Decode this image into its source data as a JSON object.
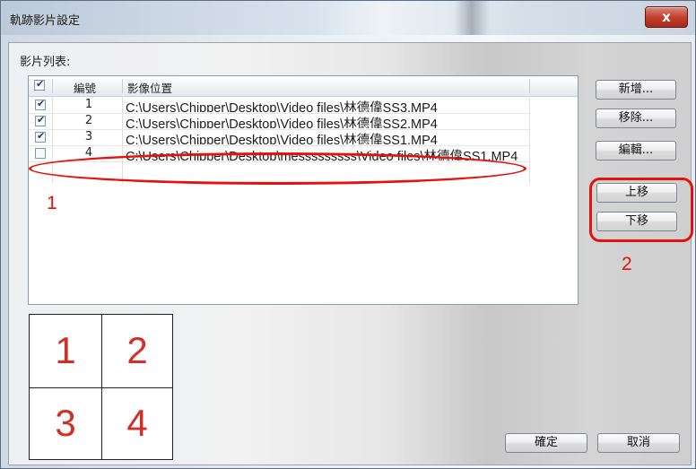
{
  "window": {
    "title": "軌跡影片設定",
    "close_label": "x"
  },
  "list": {
    "label": "影片列表:",
    "headers": {
      "number": "編號",
      "location": "影像位置"
    },
    "rows": [
      {
        "checked": true,
        "number": "1",
        "path": "C:\\Users\\Chipper\\Desktop\\Video files\\林德偉SS3.MP4"
      },
      {
        "checked": true,
        "number": "2",
        "path": "C:\\Users\\Chipper\\Desktop\\Video files\\林德偉SS2.MP4"
      },
      {
        "checked": true,
        "number": "3",
        "path": "C:\\Users\\Chipper\\Desktop\\Video files\\林德偉SS1.MP4"
      },
      {
        "checked": false,
        "number": "4",
        "path": "C:\\Users\\Chipper\\Desktop\\messsssssss\\Video files\\林德偉SS1.MP4"
      }
    ]
  },
  "buttons": {
    "add": "新增...",
    "remove": "移除...",
    "edit": "編輯...",
    "move_up": "上移",
    "move_down": "下移",
    "ok": "確定",
    "cancel": "取消"
  },
  "annotations": {
    "label_1": "1",
    "label_2": "2",
    "color": "#e6100d"
  },
  "preview": {
    "cells": [
      "1",
      "2",
      "3",
      "4"
    ],
    "digit_color": "#d22f26"
  }
}
